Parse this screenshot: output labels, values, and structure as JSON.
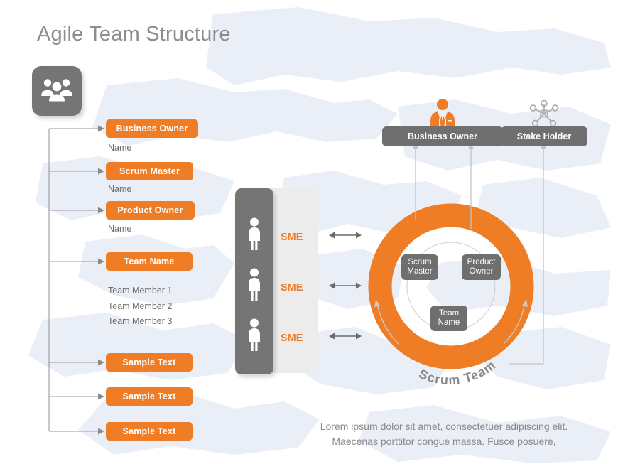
{
  "slide": {
    "title": "Agile Team Structure",
    "brand_orange": "#ee7d26",
    "brand_gray": "#6f6f6f",
    "text_gray": "#6d6d6d",
    "title_gray": "#8d8d8d"
  },
  "team_icon": {
    "name": "people-group-icon"
  },
  "left_column": {
    "items": [
      {
        "label": "Business Owner",
        "sub": "Name"
      },
      {
        "label": "Scrum Master",
        "sub": "Name"
      },
      {
        "label": "Product Owner",
        "sub": "Name"
      }
    ],
    "team": {
      "label": "Team Name",
      "members": [
        "Team Member 1",
        "Team Member 2",
        "Team Member 3"
      ]
    },
    "samples": [
      {
        "label": "Sample Text"
      },
      {
        "label": "Sample Text"
      },
      {
        "label": "Sample Text"
      }
    ]
  },
  "sme_panel": {
    "labels": [
      "SME",
      "SME",
      "SME"
    ],
    "person_icon": "person-icon"
  },
  "scrum": {
    "ring_caption": "Scrum Team",
    "inner_roles": [
      {
        "line1": "Scrum",
        "line2": "Master"
      },
      {
        "line1": "Product",
        "line2": "Owner"
      },
      {
        "line1": "Team",
        "line2": "Name"
      }
    ]
  },
  "top_roles": [
    {
      "label": "Business Owner",
      "icon": "businessman-icon"
    },
    {
      "label": "Stake Holder",
      "icon": "network-hub-icon"
    }
  ],
  "footer": {
    "line1": "Lorem ipsum dolor sit amet, consectetuer adipiscing elit.",
    "line2": "Maecenas porttitor congue massa. Fusce posuere,"
  }
}
